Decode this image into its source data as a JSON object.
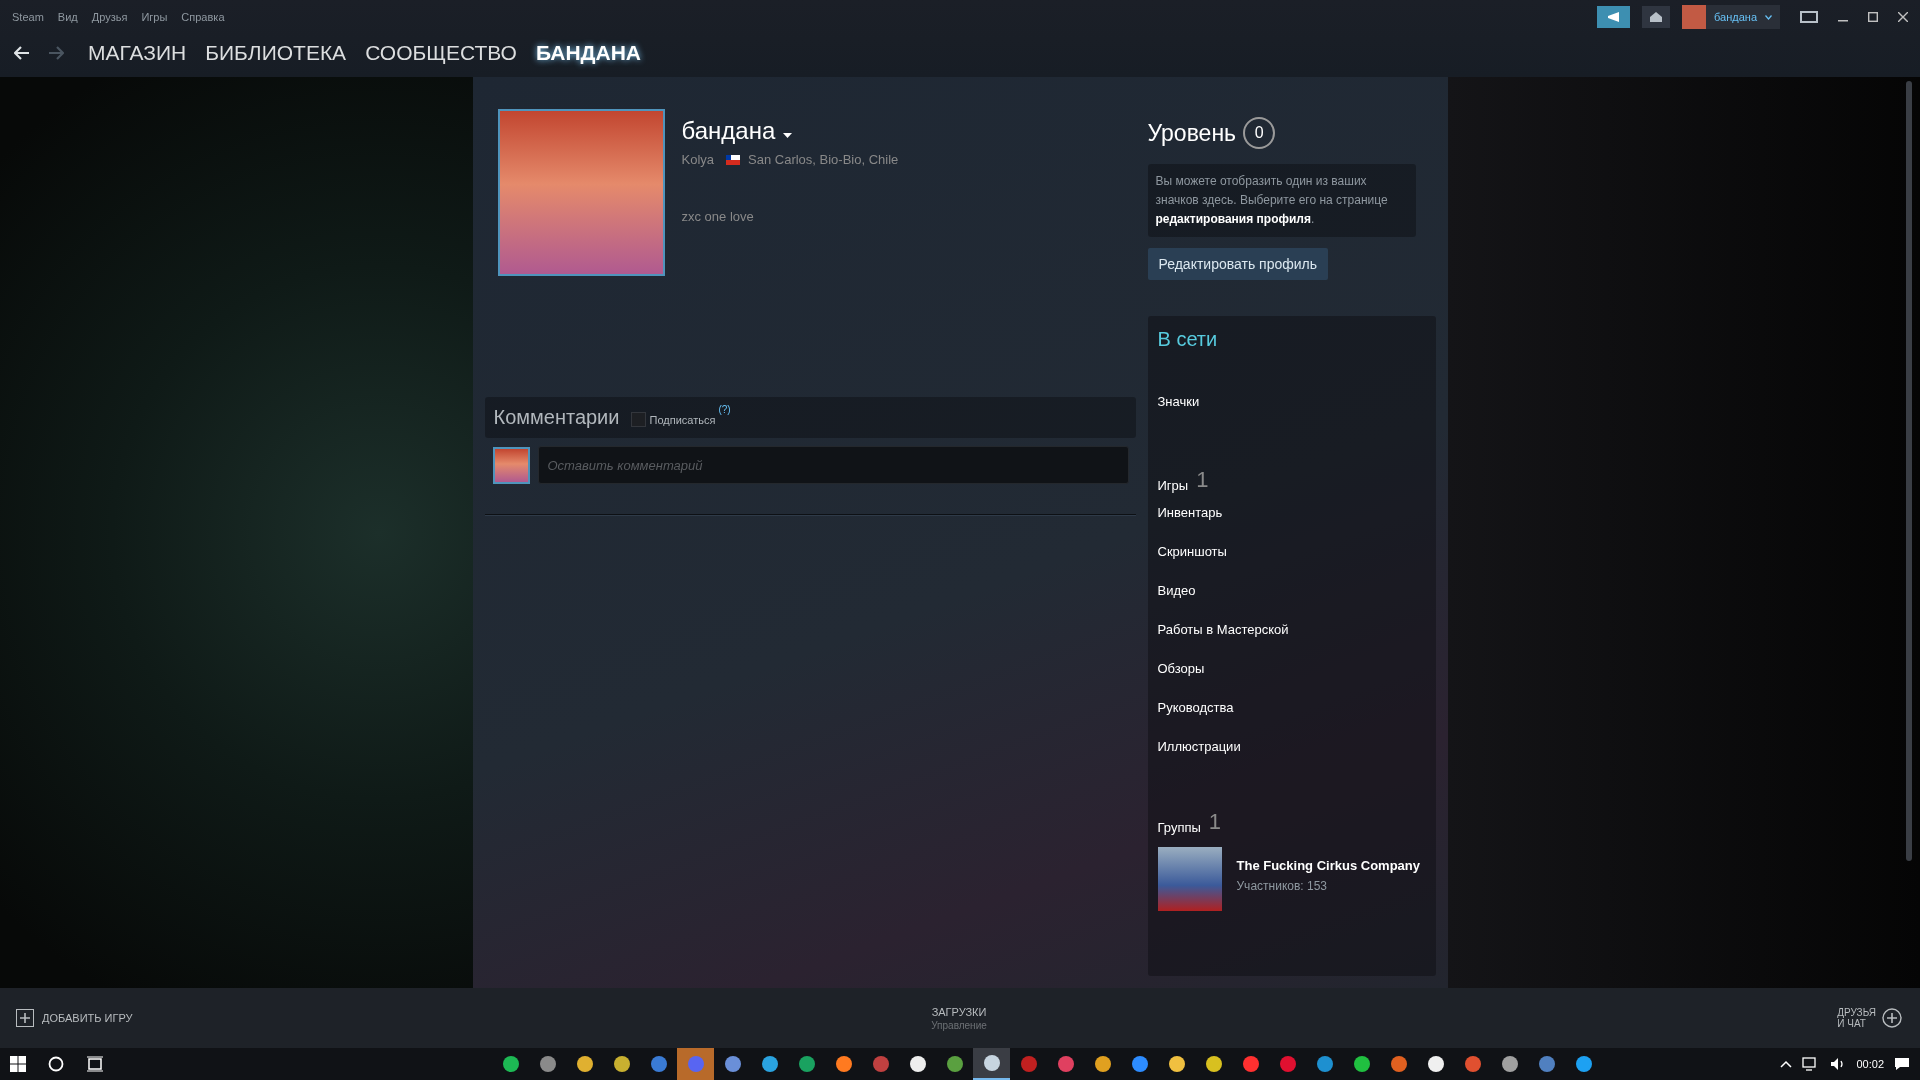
{
  "menu": [
    "Steam",
    "Вид",
    "Друзья",
    "Игры",
    "Справка"
  ],
  "nav_tabs": [
    {
      "label": "МАГАЗИН",
      "selected": false
    },
    {
      "label": "БИБЛИОТЕКА",
      "selected": false
    },
    {
      "label": "СООБЩЕСТВО",
      "selected": false
    },
    {
      "label": "БАНДАНА",
      "selected": true
    }
  ],
  "account": {
    "name": "бандана"
  },
  "profile": {
    "name": "бандана",
    "real_name": "Kolya",
    "location": "San Carlos, Bio-Bio, Chile",
    "summary": "zxc one love"
  },
  "level": {
    "label": "Уровень",
    "value": "0",
    "note": "Вы можете отобразить один из ваших значков здесь. Выберите его на странице **редактирования профиля**.",
    "edit_button": "Редактировать профиль"
  },
  "comments": {
    "title": "Комментарии",
    "subscribe": {
      "label": "Подписаться",
      "checked": false
    },
    "help": "(?)",
    "placeholder": "Оставить комментарий"
  },
  "sidebar": {
    "status": "В сети",
    "sections": [
      {
        "kind": "plain",
        "label": "Значки"
      },
      {
        "kind": "count",
        "label": "Игры",
        "count": "1"
      },
      {
        "kind": "link",
        "label": "Инвентарь"
      },
      {
        "kind": "link",
        "label": "Скриншоты"
      },
      {
        "kind": "link",
        "label": "Видео"
      },
      {
        "kind": "link",
        "label": "Работы в Мастерской"
      },
      {
        "kind": "link",
        "label": "Обзоры"
      },
      {
        "kind": "link",
        "label": "Руководства"
      },
      {
        "kind": "link",
        "label": "Иллюстрации"
      },
      {
        "kind": "group_count",
        "label": "Группы",
        "count": "1"
      }
    ],
    "groups": [
      {
        "name": "The Fucking Cirkus Company",
        "members": "Участников: 153"
      }
    ]
  },
  "bottom_bar": {
    "add_game": "ДОБАВИТЬ ИГРУ",
    "downloads": "ЗАГРУЗКИ",
    "downloads_sub": "Управление",
    "friends": "ДРУЗЬЯ\nИ ЧАТ"
  },
  "taskbar": {
    "time": "00:02",
    "apps": [
      {
        "color": "#1db954",
        "selected": false,
        "attention": false
      },
      {
        "color": "#8a8a8a",
        "selected": false,
        "attention": false
      },
      {
        "color": "#e0b030",
        "selected": false,
        "attention": false
      },
      {
        "color": "#c8b030",
        "selected": false,
        "attention": false
      },
      {
        "color": "#3a7bd5",
        "selected": false,
        "attention": false
      },
      {
        "color": "#5865f2",
        "selected": false,
        "attention": true
      },
      {
        "color": "#6a8fd8",
        "selected": false,
        "attention": false
      },
      {
        "color": "#2aa3e0",
        "selected": false,
        "attention": false
      },
      {
        "color": "#1aa260",
        "selected": false,
        "attention": false
      },
      {
        "color": "#ff7a20",
        "selected": false,
        "attention": false
      },
      {
        "color": "#c04040",
        "selected": false,
        "attention": false
      },
      {
        "color": "#eeeeee",
        "selected": false,
        "attention": false
      },
      {
        "color": "#5aa040",
        "selected": false,
        "attention": false
      },
      {
        "color": "#c7d5e0",
        "selected": true,
        "attention": false
      },
      {
        "color": "#c02020",
        "selected": false,
        "attention": false
      },
      {
        "color": "#e04060",
        "selected": false,
        "attention": false
      },
      {
        "color": "#e0a020",
        "selected": false,
        "attention": false
      },
      {
        "color": "#2d8cff",
        "selected": false,
        "attention": false
      },
      {
        "color": "#f0c040",
        "selected": false,
        "attention": false
      },
      {
        "color": "#d8c020",
        "selected": false,
        "attention": false
      },
      {
        "color": "#ff3030",
        "selected": false,
        "attention": false
      },
      {
        "color": "#e01030",
        "selected": false,
        "attention": false
      },
      {
        "color": "#1e90d0",
        "selected": false,
        "attention": false
      },
      {
        "color": "#20c040",
        "selected": false,
        "attention": false
      },
      {
        "color": "#e06020",
        "selected": false,
        "attention": false
      },
      {
        "color": "#f0f0f0",
        "selected": false,
        "attention": false
      },
      {
        "color": "#e05030",
        "selected": false,
        "attention": false
      },
      {
        "color": "#a0a0a0",
        "selected": false,
        "attention": false
      },
      {
        "color": "#5080c0",
        "selected": false,
        "attention": false
      },
      {
        "color": "#1da1f2",
        "selected": false,
        "attention": false
      }
    ]
  }
}
